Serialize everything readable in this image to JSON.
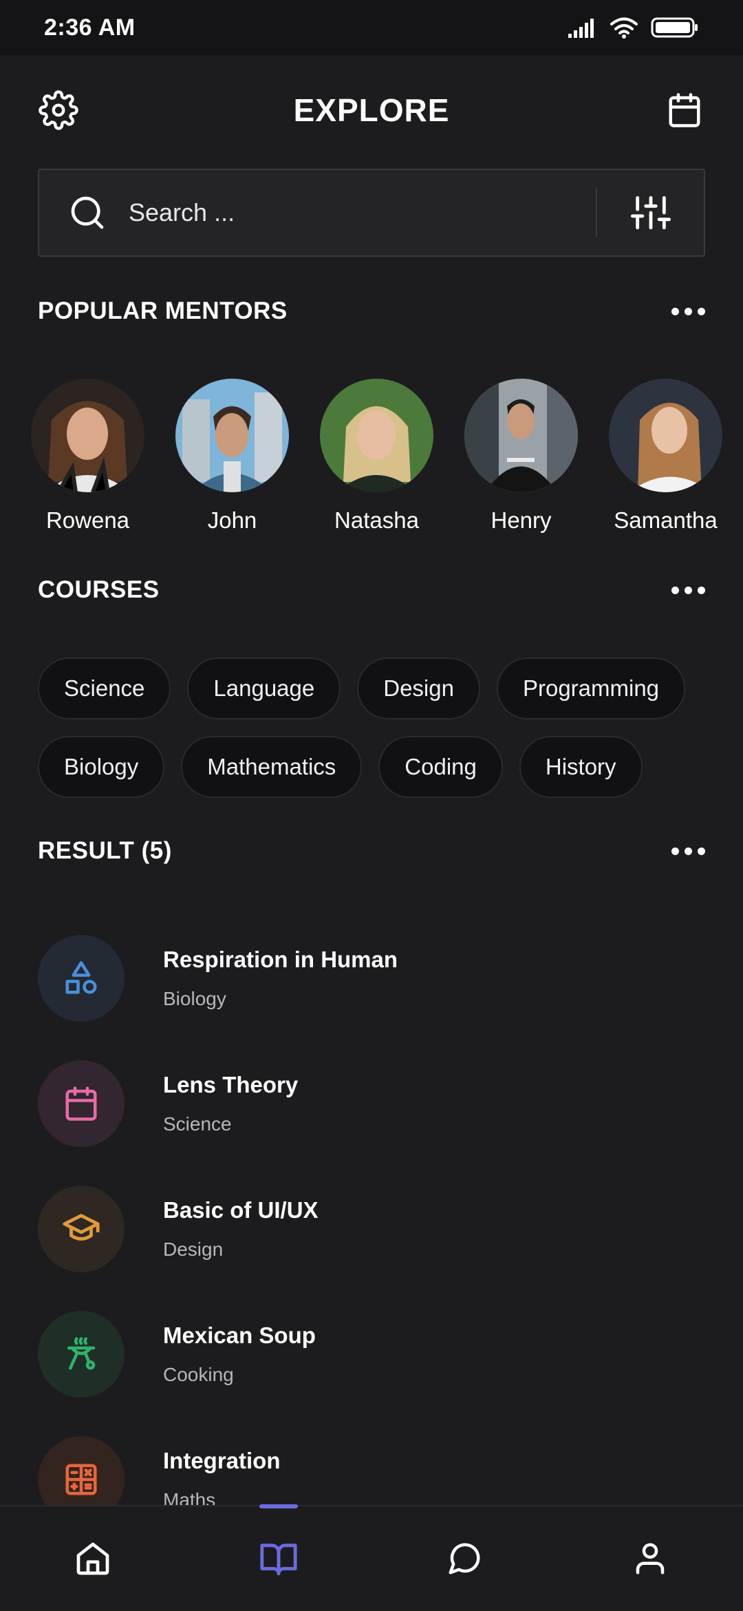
{
  "status_bar": {
    "time": "2:36 AM"
  },
  "header": {
    "title": "EXPLORE"
  },
  "search": {
    "placeholder": "Search ..."
  },
  "mentors": {
    "title": "POPULAR MENTORS",
    "items": [
      {
        "name": "Rowena"
      },
      {
        "name": "John"
      },
      {
        "name": "Natasha"
      },
      {
        "name": "Henry"
      },
      {
        "name": "Samantha"
      }
    ]
  },
  "courses": {
    "title": "COURSES",
    "row1": [
      "Science",
      "Language",
      "Design",
      "Programming"
    ],
    "row2": [
      "Biology",
      "Mathematics",
      "Coding",
      "History"
    ]
  },
  "results": {
    "title": "RESULT (5)",
    "items": [
      {
        "title": "Respiration in Human",
        "subtitle": "Biology",
        "icon": "shapes-icon",
        "color": "#4a90d9"
      },
      {
        "title": "Lens Theory",
        "subtitle": "Science",
        "icon": "calendar-icon",
        "color": "#e86aa6"
      },
      {
        "title": "Basic of UI/UX",
        "subtitle": "Design",
        "icon": "graduation-cap-icon",
        "color": "#e09a3a"
      },
      {
        "title": "Mexican Soup",
        "subtitle": "Cooking",
        "icon": "grill-icon",
        "color": "#2fb36b"
      },
      {
        "title": "Integration",
        "subtitle": "Maths",
        "icon": "calculator-icon",
        "color": "#e8663a"
      }
    ]
  },
  "nav": {
    "active": "courses",
    "active_color": "#6b6bdf"
  }
}
